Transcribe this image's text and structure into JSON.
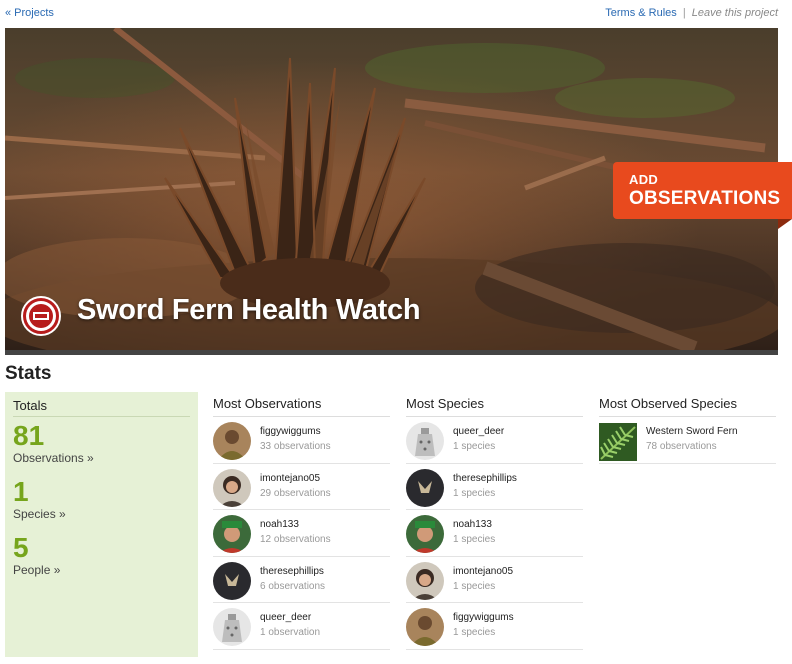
{
  "topbar": {
    "back_label": "« Projects",
    "terms_label": "Terms & Rules",
    "separator": "|",
    "leave_label": "Leave this project"
  },
  "hero": {
    "title": "Sword Fern Health Watch",
    "add_small": "ADD",
    "add_big": "OBSERVATIONS"
  },
  "stats": {
    "heading": "Stats",
    "totals": {
      "heading": "Totals",
      "items": [
        {
          "value": "81",
          "label": "Observations »"
        },
        {
          "value": "1",
          "label": "Species »"
        },
        {
          "value": "5",
          "label": "People »"
        }
      ]
    },
    "most_observations": {
      "heading": "Most Observations",
      "rows": [
        {
          "name": "figgywiggums",
          "sub": "33 observations",
          "avatar": "fern-person"
        },
        {
          "name": "imontejano05",
          "sub": "29 observations",
          "avatar": "glasses-person"
        },
        {
          "name": "noah133",
          "sub": "12 observations",
          "avatar": "green-hat-person"
        },
        {
          "name": "theresephillips",
          "sub": "6 observations",
          "avatar": "shirt-print"
        },
        {
          "name": "queer_deer",
          "sub": "1 observation",
          "avatar": "robot"
        }
      ]
    },
    "most_species": {
      "heading": "Most Species",
      "rows": [
        {
          "name": "queer_deer",
          "sub": "1 species",
          "avatar": "robot"
        },
        {
          "name": "theresephillips",
          "sub": "1 species",
          "avatar": "shirt-print"
        },
        {
          "name": "noah133",
          "sub": "1 species",
          "avatar": "green-hat-person"
        },
        {
          "name": "imontejano05",
          "sub": "1 species",
          "avatar": "glasses-person"
        },
        {
          "name": "figgywiggums",
          "sub": "1 species",
          "avatar": "fern-person"
        }
      ]
    },
    "most_observed_species": {
      "heading": "Most Observed Species",
      "rows": [
        {
          "name": "Western Sword Fern",
          "sub": "78 observations"
        }
      ]
    }
  },
  "colors": {
    "link": "#2a6ab3",
    "accent_green": "#76a51c",
    "totals_bg": "#e6f1d6",
    "add_button": "#e84a1e"
  }
}
